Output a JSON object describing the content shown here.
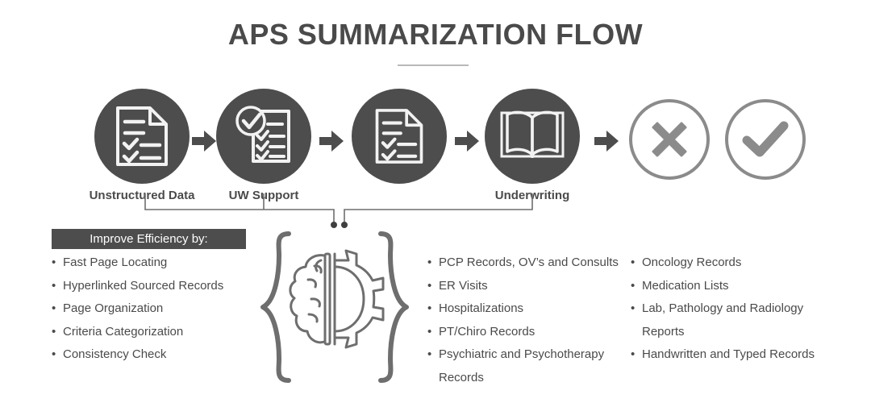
{
  "header": {
    "title": "APS SUMMARIZATION FLOW",
    "divider": "title-divider"
  },
  "colors": {
    "dark_gray": "#4d4d4d",
    "mid_gray": "#8b8b8b",
    "text_gray": "#4a4a4a",
    "rule_gray": "#b9b9b9",
    "white": "#ffffff"
  },
  "flow": {
    "steps": [
      {
        "label": "Unstructured Data",
        "icon": "document-checklist-icon",
        "style": "filled"
      },
      {
        "label": "UW Support",
        "icon": "checklist-approved-icon",
        "style": "filled"
      },
      {
        "label": "",
        "icon": "document-checklist-icon",
        "style": "filled"
      },
      {
        "label": "Underwriting",
        "icon": "open-book-icon",
        "style": "filled"
      },
      {
        "label": "",
        "icon": "cross-circle-icon",
        "style": "outline"
      },
      {
        "label": "",
        "icon": "check-circle-icon",
        "style": "outline"
      }
    ],
    "arrows": [
      "arrow-right-icon",
      "arrow-right-icon",
      "arrow-right-icon",
      "arrow-right-icon"
    ]
  },
  "efficiency": {
    "heading": "Improve Efficiency by:",
    "items": [
      "Fast Page Locating",
      "Hyperlinked Sourced Records",
      "Page Organization",
      "Criteria Categorization",
      "Consistency Check"
    ]
  },
  "ai_block": {
    "icon": "brain-gear-icon",
    "left_brace": "left-curly-brace",
    "right_brace": "right-curly-brace"
  },
  "records": {
    "column_1": [
      "PCP Records, OV’s and Consults",
      "ER Visits",
      "Hospitalizations",
      "PT/Chiro Records",
      "Psychiatric and Psychotherapy Records"
    ],
    "column_2": [
      "Oncology Records",
      "Medication Lists",
      "Lab, Pathology and Radiology Reports",
      "Handwritten and Typed Records"
    ]
  }
}
